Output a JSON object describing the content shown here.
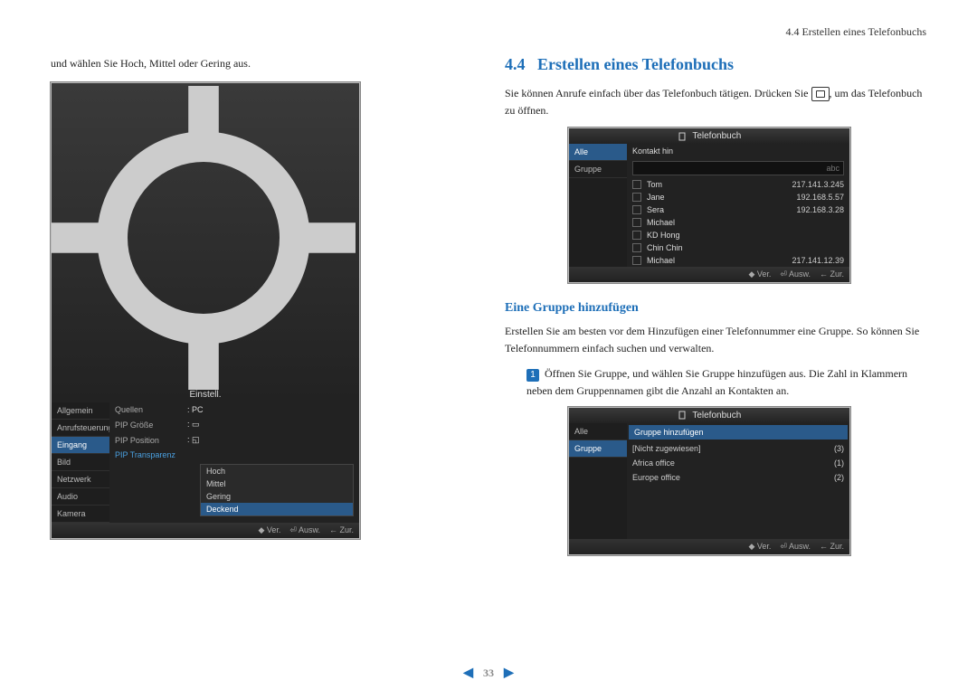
{
  "header": "4.4 Erstellen eines Telefonbuchs",
  "left": {
    "lead": "und wählen Sie Hoch, Mittel oder Gering aus.",
    "shot1": {
      "title": "Einstell.",
      "tabs": [
        "Allgemein",
        "Anrufsteuerung",
        "Eingang",
        "Bild",
        "Netzwerk",
        "Audio",
        "Kamera"
      ],
      "tab_sel": 2,
      "rows": [
        {
          "lab": "Quellen",
          "val": ": PC"
        },
        {
          "lab": "PIP Größe",
          "val": ": ▭"
        },
        {
          "lab": "PIP Position",
          "val": ": ◱"
        },
        {
          "lab": "PIP Transparenz",
          "val": ""
        }
      ],
      "blue_row": 3,
      "sub": [
        "Hoch",
        "Mittel",
        "Gering",
        "Deckend"
      ],
      "sub_sel": 3,
      "footer": [
        "◆ Ver.",
        "⏎ Ausw.",
        "← Zur."
      ]
    }
  },
  "right": {
    "h2_num": "4.4",
    "h2": "Erstellen eines Telefonbuchs",
    "p1a": "Sie können Anrufe einfach über das Telefonbuch tätigen. Drücken Sie ",
    "p1b": ", um das Telefonbuch zu öffnen.",
    "shot2": {
      "title": "Telefonbuch",
      "tabs": [
        "Alle",
        "Gruppe"
      ],
      "tab_sel": 0,
      "add_label": "Kontakt hin",
      "search_ph": "abc",
      "contacts": [
        {
          "n": "Tom",
          "ip": "217.141.3.245"
        },
        {
          "n": "Jane",
          "ip": "192.168.5.57"
        },
        {
          "n": "Sera",
          "ip": "192.168.3.28"
        },
        {
          "n": "Michael",
          "ip": ""
        },
        {
          "n": "KD Hong",
          "ip": ""
        },
        {
          "n": "Chin Chin",
          "ip": ""
        },
        {
          "n": "Michael",
          "ip": "217.141.12.39"
        }
      ],
      "footer": [
        "◆ Ver.",
        "⏎ Ausw.",
        "← Zur."
      ]
    },
    "h3": "Eine Gruppe hinzufügen",
    "p2": "Erstellen Sie am besten vor dem Hinzufügen einer Telefonnummer eine Gruppe. So können Sie Telefonnummern einfach suchen und verwalten.",
    "step1": "Öffnen Sie Gruppe, und wählen Sie Gruppe hinzufügen aus. Die Zahl in Klammern neben dem Gruppennamen gibt die Anzahl an Kontakten an.",
    "shot3": {
      "title": "Telefonbuch",
      "tabs": [
        "Alle",
        "Gruppe"
      ],
      "tab_sel": 1,
      "action": "Gruppe hinzufügen",
      "groups": [
        {
          "g": "[Nicht zugewiesen]",
          "c": "(3)"
        },
        {
          "g": "Africa office",
          "c": "(1)"
        },
        {
          "g": "Europe office",
          "c": "(2)"
        }
      ],
      "footer": [
        "◆ Ver.",
        "⏎ Ausw.",
        "← Zur."
      ]
    }
  },
  "page_no": "33"
}
